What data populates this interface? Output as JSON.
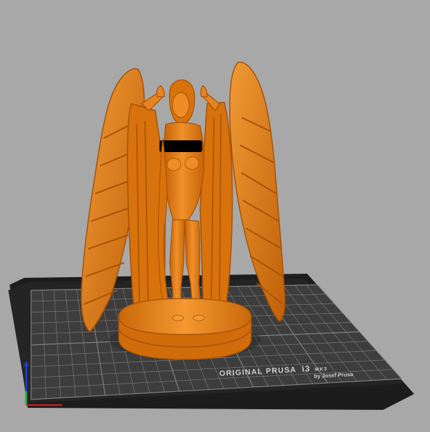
{
  "viewport": {
    "background": "#a8a8a8",
    "bed": {
      "brand_line1_a": "ORIGINAL PRUSA",
      "brand_line1_b": "i3",
      "brand_line1_c": "MK3",
      "brand_line2": "by Josef Prusa",
      "surface_color": "#3d3d3d",
      "frame_color": "#1c1c1c",
      "grid_color": "#8a8a8a"
    },
    "model": {
      "color": "#e07a10",
      "shadow_color": "#b85c00",
      "highlight_color": "#f29a35",
      "censor_color": "#000000"
    },
    "axes": {
      "x_color": "#c02020",
      "y_color": "#20b040",
      "z_color": "#2040d0"
    }
  }
}
